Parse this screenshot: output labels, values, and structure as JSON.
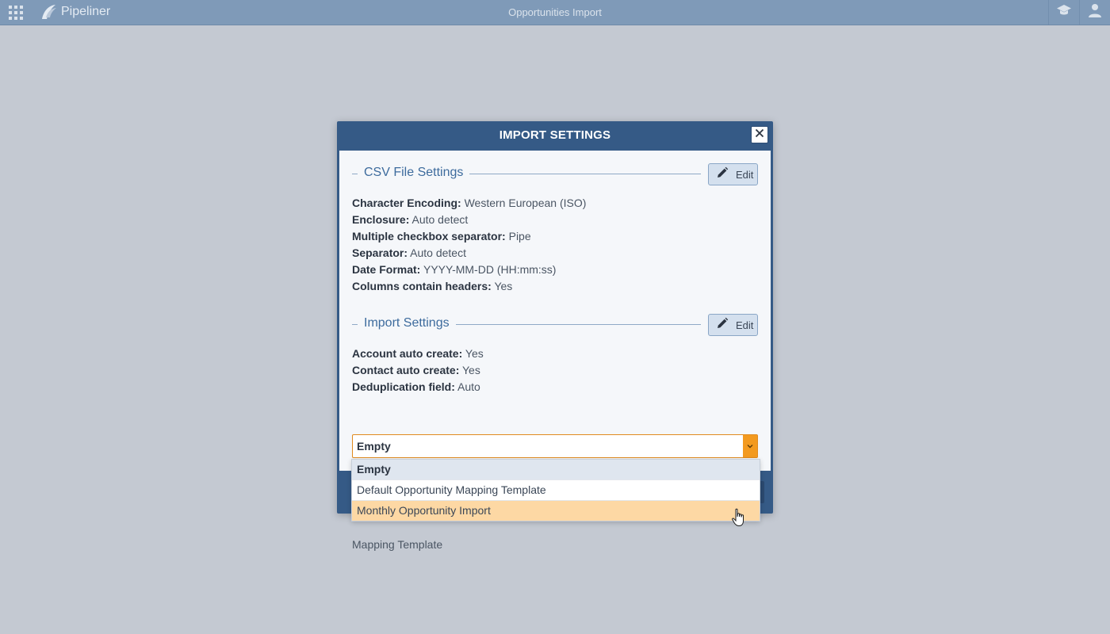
{
  "app": {
    "brand": "Pipeliner",
    "page_title": "Opportunities Import"
  },
  "topbar": {
    "icons": [
      "apps-grid-icon",
      "graduation-cap-icon",
      "user-icon"
    ]
  },
  "modal": {
    "title": "IMPORT SETTINGS",
    "csv_section": {
      "title": "CSV File Settings",
      "edit_label": "Edit",
      "rows": [
        {
          "key": "Character Encoding:",
          "value": "Western European (ISO)"
        },
        {
          "key": "Enclosure:",
          "value": "Auto detect"
        },
        {
          "key": "Multiple checkbox separator:",
          "value": "Pipe"
        },
        {
          "key": "Separator:",
          "value": "Auto detect"
        },
        {
          "key": "Date Format:",
          "value": "YYYY-MM-DD (HH:mm:ss)"
        },
        {
          "key": "Columns contain headers:",
          "value": "Yes"
        }
      ]
    },
    "import_section": {
      "title": "Import Settings",
      "edit_label": "Edit",
      "rows": [
        {
          "key": "Account auto create:",
          "value": "Yes"
        },
        {
          "key": "Contact auto create:",
          "value": "Yes"
        },
        {
          "key": "Deduplication field:",
          "value": "Auto"
        }
      ]
    },
    "mapping_template": {
      "label": "Mapping Template",
      "selected": "Empty",
      "options": [
        "Empty",
        "Default Opportunity Mapping Template",
        "Monthly Opportunity Import"
      ],
      "selected_index": 0,
      "hover_index": 2
    }
  },
  "colors": {
    "modal_header": "#355a86",
    "accent_orange": "#f39a1f",
    "hover_row": "#fdd8a4",
    "section_title": "#3d6b9d"
  }
}
